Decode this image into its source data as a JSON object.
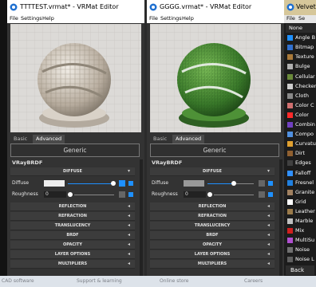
{
  "left_window": {
    "title": "TTTTEST.vrmat* - VRMat Editor",
    "menu": [
      "File",
      "Settings",
      "Help"
    ],
    "tabs": [
      "Basic",
      "Advanced"
    ],
    "generic_label": "Generic",
    "material": "VRayBRDF",
    "sections": [
      "DIFFUSE",
      "REFLECTION",
      "REFRACTION",
      "TRANSLUCENCY",
      "BRDF",
      "OPACITY",
      "LAYER OPTIONS",
      "MULTIPLIERS"
    ],
    "diffuse_label": "Diffuse",
    "roughness_label": "Roughness",
    "roughness_value": "0",
    "diffuse_color": "#eeeeee"
  },
  "right_window": {
    "title": "GGGG.vrmat* - VRMat Editor",
    "menu": [
      "File",
      "Settings",
      "Help"
    ],
    "tabs": [
      "Basic",
      "Advanced"
    ],
    "generic_label": "Generic",
    "material": "VRayBRDF",
    "sections": [
      "DIFFUSE",
      "REFLECTION",
      "REFRACTION",
      "TRANSLUCENCY",
      "BRDF",
      "OPACITY",
      "LAYER OPTIONS",
      "MULTIPLIERS"
    ],
    "diffuse_label": "Diffuse",
    "roughness_label": "Roughness",
    "roughness_value": "0",
    "diffuse_color": "#999999"
  },
  "texture_panel": {
    "title": "Velvet",
    "menu": [
      "File",
      "Se"
    ],
    "items": [
      "None",
      "Angle B",
      "Bitmap",
      "Texture",
      "Bulge",
      "Cellular",
      "Checker",
      "Cloth",
      "Color C",
      "Color",
      "Combin",
      "Compo",
      "Curvatu",
      "Dirt",
      "Edges",
      "Falloff",
      "Fresnel",
      "Granite",
      "Grid",
      "Leather",
      "Marble",
      "Mix",
      "MultiSu",
      "Noise",
      "Noise L"
    ],
    "back_label": "Back"
  },
  "bottom_bar": [
    "CAD software",
    "Support & learning",
    "Online store",
    "Careers"
  ],
  "colors": {
    "accent": "#1e90ff",
    "panel_title": "#d6c79a",
    "grass": "#3a7a2a"
  }
}
